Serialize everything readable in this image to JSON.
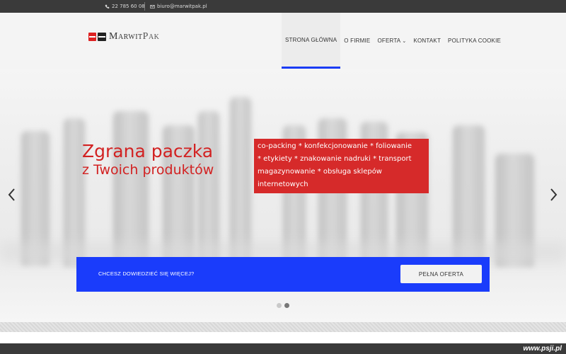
{
  "topbar": {
    "phone": "22 785 60 08",
    "email": "biuro@marwitpak.pl"
  },
  "logo": {
    "part1": "Marwit",
    "part2": "Pak",
    "colors": {
      "red": "#dd2222",
      "dark": "#222222"
    }
  },
  "nav": {
    "items": [
      {
        "label": "STRONA GŁÓWNA",
        "active": true
      },
      {
        "label": "O FIRMIE"
      },
      {
        "label": "OFERTA",
        "dropdown": true
      },
      {
        "label": "KONTAKT"
      },
      {
        "label": "POLITYKA COOKIE"
      }
    ]
  },
  "hero": {
    "headline_line1": "Zgrana paczka",
    "headline_line2": "z Twoich produktów",
    "services_lines": [
      "co-packing * konfekcjonowanie * foliowanie",
      "* etykiety * znakowanie nadruki * transport",
      "magazynowanie * obsługa sklepów",
      "internetowych"
    ]
  },
  "cta": {
    "text": "CHCESZ DOWIEDZIEĆ SIĘ WIĘCEJ?",
    "button_label": "PEŁNA OFERTA"
  },
  "slider": {
    "slide_count": 2,
    "active_index": 1
  },
  "footer": {
    "watermark": "www.psji.pl"
  },
  "colors": {
    "accent_blue": "#1a3cfb",
    "accent_red": "#d62a2a",
    "topbar": "#3a3a3a"
  }
}
